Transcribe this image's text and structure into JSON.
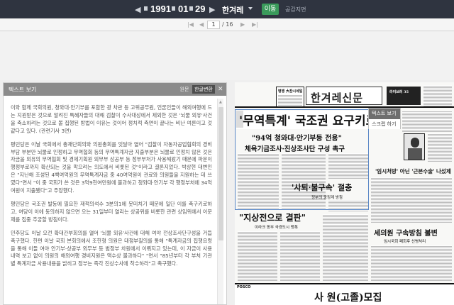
{
  "toolbar": {
    "prev_year_glyph": "◀",
    "year": "1991",
    "month": "01",
    "day": "29",
    "next_day_glyph": "▶",
    "newspaper": "한겨레",
    "go_label": "이동",
    "guide_label": "공감지면"
  },
  "pagination": {
    "first_glyph": "|◀",
    "prev_glyph": "◀",
    "current": "1",
    "total": "/ 16",
    "next_glyph": "▶",
    "last_glyph": "▶|"
  },
  "text_panel": {
    "title": "텍스트 보기",
    "original_label": "원문",
    "convert_label": "한글변환",
    "close_glyph": "✕",
    "paragraphs": [
      " 이와 함께 국회의원, 청와대·안기부를 포함한 광 차관 등 고위공무원, 언론인들이 해외여행에 드는 지원받은 것으로 알려진 특혜자들의 대해 검찰이 수사대상에서 제외한 것은 '뇌물 외유'사건을 축소하려는 것으로 볼 집행된 방법이 이유는 것이어 정치적 측면이 끝나는 비난 여론이고 것 같다고 있다. (관련기사 3면)",
      " 평민당은 이날 국회에서 총재단회의와 의원총회를 잇달아 열어 \"검찰이 자동자공업협회의 경비부담 부분만 뇌물로 인정하고 무역협회 등의 무역특계자금 지출부분은 뇌물로 인정치 않은 것은 자금을 외유의 무역협회 및 경제기획원 외무부 상공부 등 정부부처가 사용해왔기 때문에 파문이 행정부로까지 확산되는 것을 막으려는 의도에서 비롯된 것\"이라고 결론지었다. 박상현 대변인은 \"지난해 조성된 4백여억원의 무역특계자금 중 40여억원이 관료와 의원들을 지원하는 데 쓰였다\"면서 \"이 중 국회가 쓴 것은 3억9천여만원에 불과하고 청와대·안기부 각 행정부처에 34억여원이 지출됐다\"고 주장했다.",
      " 평민당은 국조권 발동에 필요한 재적의석수 3분의1에 못미치기 때문에 일단 이를 촉구키로하고, 여당이 이에 동의하지 않으면 오는 31일부터 열리는 상공위를 비롯한 관련 상임위에서 이문제를 집중 추궁할 방침이다.",
      " 민주당도 이날 오전 확대간부회의를 열어 '뇌물 외유'사건에 대해 여야 전상조사단구성을 거듭 촉구했다. 한편 이날 국회 본회의에서 조한형 의원은 대정부질의를 통해 \"특계자금의 집행요령을 통해 이들 여야 안기부·상공부 외무부 등 범정부 차원에서 이뤄지고 있는데, 이 자금이 사용내역 보고 없이 의원의 해외여행 경비지원은 액수상 불과하다\" \"면서 \"85년부터 각 부처 기관별 특계자금 사용내용을 밝히고 정부는 즉각 진상수사에 착수하라\"고 촉구했다."
    ]
  },
  "newspaper_page": {
    "masthead": "한겨레신문",
    "headline": "'무역특계' 국조권 요구키로",
    "popup_text_view": "텍스트 보기",
    "popup_scrap": "스크랩 하기",
    "sub1": "\"94억 청와대·안기부등 전용\"",
    "sub2": "체육기금조사·진상조사단 구성 촉구",
    "side_head": "'사퇴·불구속' 절충",
    "bottom_head": "\"지상전으로 결판\"",
    "right_head": "'임시처방' 아닌 '근본수술' 나섰제",
    "arrest_head": "세의원 구속방침 불변",
    "sub_small1": "이라크 동부 국경도시 맹폭",
    "sub_small2": "정부의 중징계 방침",
    "sub_small3": "임시국회 폐회후 신병처리",
    "posco": "POSCO",
    "ad": "사 원(고졸)모집",
    "promo_label": "라이브러 35",
    "event_label": "병행 大잔시세일"
  }
}
